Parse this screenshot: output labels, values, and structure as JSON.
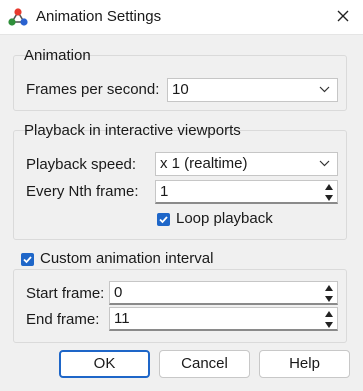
{
  "window": {
    "title": "Animation Settings"
  },
  "animation_group": {
    "title": "Animation",
    "fps_label": "Frames per second:",
    "fps_value": "10"
  },
  "playback_group": {
    "title": "Playback in interactive viewports",
    "speed_label": "Playback speed:",
    "speed_value": "x 1 (realtime)",
    "nth_label": "Every Nth frame:",
    "nth_value": "1",
    "loop_label": "Loop playback",
    "loop_checked": true
  },
  "interval_group": {
    "title": "Custom animation interval",
    "custom_checked": true,
    "start_label": "Start frame:",
    "start_value": "0",
    "end_label": "End frame:",
    "end_value": "11"
  },
  "buttons": {
    "ok": "OK",
    "cancel": "Cancel",
    "help": "Help"
  },
  "colors": {
    "accent": "#1e66c8",
    "background": "#f0f0f0"
  }
}
